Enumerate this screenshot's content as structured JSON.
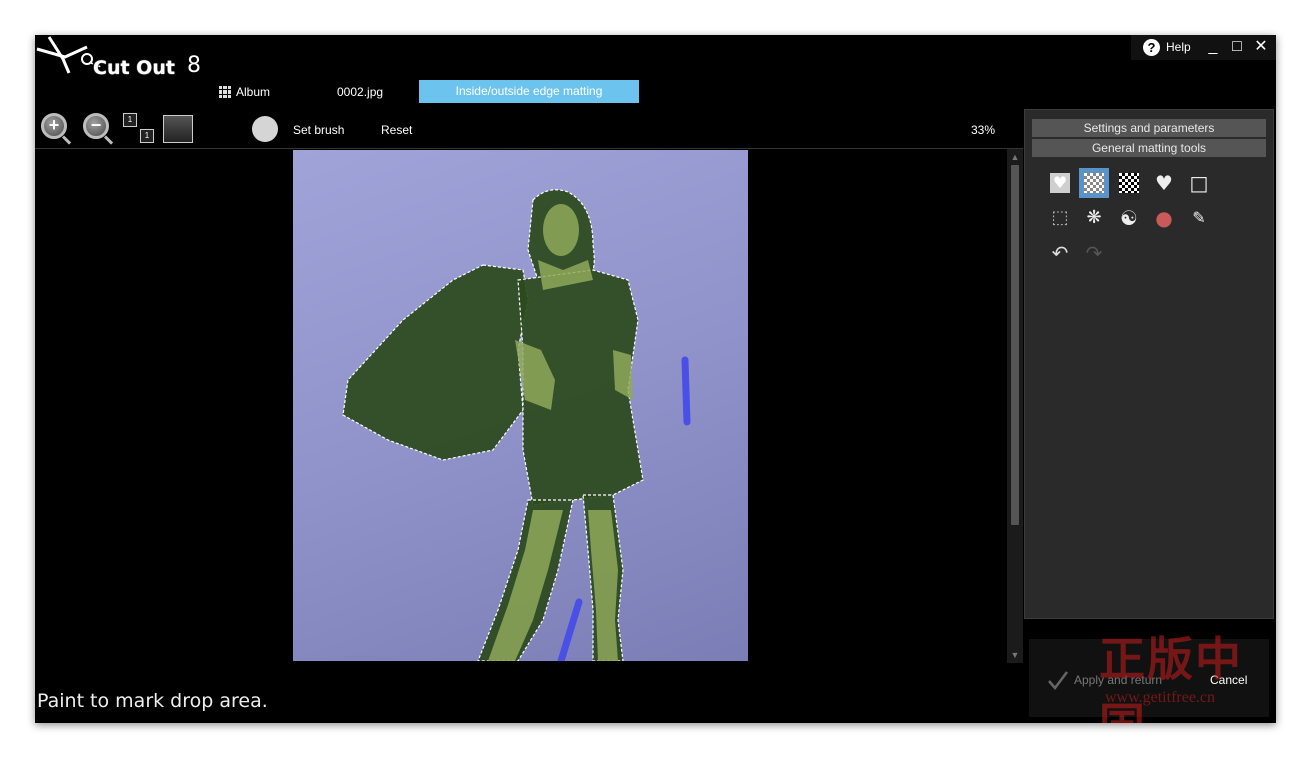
{
  "app": {
    "logo_text": "Cut Out",
    "logo_version": "8",
    "help_label": "Help"
  },
  "window_controls": {
    "minimize": "_",
    "maximize": "□",
    "close": "✕"
  },
  "nav": {
    "album_label": "Album",
    "file_name": "0002.jpg",
    "mode_label": "Inside/outside edge matting"
  },
  "toolbar": {
    "zoom_in_sign": "+",
    "zoom_out_sign": "−",
    "actual_size_a": "1",
    "actual_size_b": "1",
    "set_brush_label": "Set brush",
    "reset_label": "Reset",
    "zoom_level": "33%"
  },
  "panel": {
    "settings_header": "Settings and parameters",
    "tools_header": "General matting tools",
    "tools": [
      {
        "name": "keep-heart-tool",
        "glyph": "♥",
        "selected": false
      },
      {
        "name": "transparent-checker-tool",
        "glyph": "",
        "selected": true
      },
      {
        "name": "dark-checker-tool",
        "glyph": "",
        "selected": false
      },
      {
        "name": "heart-tool",
        "glyph": "♥",
        "selected": false
      },
      {
        "name": "square-tool",
        "glyph": "□",
        "selected": false
      },
      {
        "name": "lasso-tool",
        "glyph": "⬚",
        "selected": false
      },
      {
        "name": "blob-brush-tool",
        "glyph": "❋",
        "selected": false
      },
      {
        "name": "yin-yang-tool",
        "glyph": "☯",
        "selected": false
      },
      {
        "name": "color-ball-tool",
        "glyph": "●",
        "selected": false
      },
      {
        "name": "feather-tool",
        "glyph": "✎",
        "selected": false
      },
      {
        "name": "undo-tool",
        "glyph": "↶",
        "selected": false
      },
      {
        "name": "redo-tool",
        "glyph": "↷",
        "selected": false
      }
    ]
  },
  "actions": {
    "apply_label": "Apply and return",
    "cancel_label": "Cancel"
  },
  "watermark": {
    "big": "正版中国",
    "small": "www.getitfree.cn"
  },
  "status": {
    "message": "Paint to mark drop area."
  },
  "colors": {
    "mode_tab_bg": "#6cc4ee",
    "selected_tool_bg": "#5a93c8",
    "background_photo": "#9a9dd4",
    "foreground_mask": "#1e3a14",
    "stroke_blue": "#4a4fe6"
  }
}
